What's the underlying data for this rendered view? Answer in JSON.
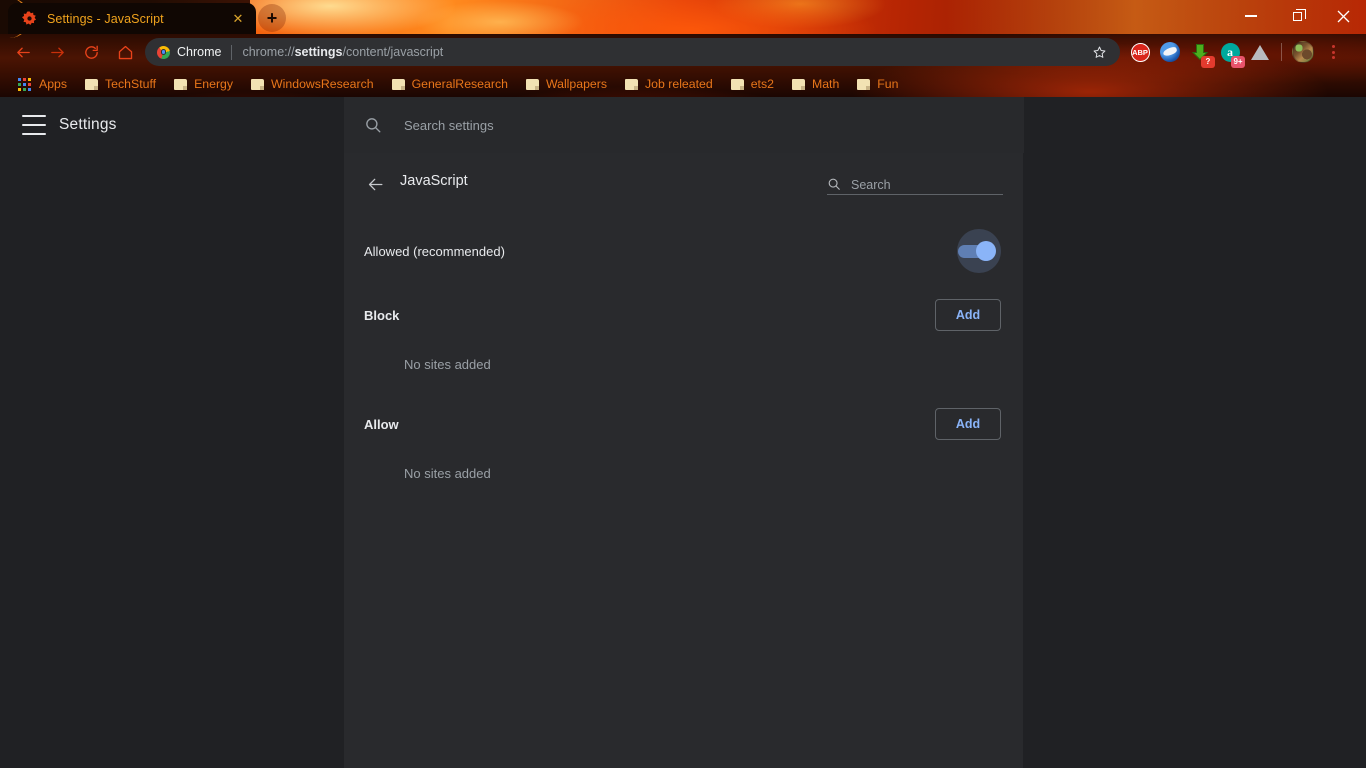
{
  "window": {
    "controls": [
      {
        "name": "minimize",
        "label": "–"
      },
      {
        "name": "maximize",
        "label": "❐"
      },
      {
        "name": "close",
        "label": "✕"
      }
    ]
  },
  "browser": {
    "tab": {
      "title": "Settings - JavaScript",
      "favicon": "gear-icon",
      "close_label": "✕"
    },
    "newtab_label": "+",
    "nav": {
      "back": "back-arrow-icon",
      "forward": "forward-arrow-icon",
      "reload": "reload-icon",
      "home": "home-icon"
    },
    "omnibox": {
      "chip_label": "Chrome",
      "url_prefix": "chrome://",
      "url_bold": "settings",
      "url_suffix": "/content/javascript",
      "full_url": "chrome://settings/content/javascript",
      "star_label": "☆"
    },
    "extensions": [
      {
        "name": "adblock-plus-icon",
        "label": "ABP",
        "badge": ""
      },
      {
        "name": "blue-globe-extension-icon",
        "label": "",
        "badge": ""
      },
      {
        "name": "download-extension-icon",
        "label": "",
        "badge": "?"
      },
      {
        "name": "a-extension-icon",
        "label": "a",
        "badge": "9+"
      },
      {
        "name": "triangle-extension-icon",
        "label": "",
        "badge": ""
      }
    ],
    "profile": {
      "name": "avatar"
    },
    "menu_label": "⋮",
    "bookmarks": [
      {
        "name": "apps",
        "label": "Apps",
        "icon": "apps-grid-icon"
      },
      {
        "name": "techstuff",
        "label": "TechStuff",
        "icon": "folder-icon"
      },
      {
        "name": "energy",
        "label": "Energy",
        "icon": "folder-icon"
      },
      {
        "name": "windowsresearch",
        "label": "WindowsResearch",
        "icon": "folder-icon"
      },
      {
        "name": "generalresearch",
        "label": "GeneralResearch",
        "icon": "folder-icon"
      },
      {
        "name": "wallpapers",
        "label": "Wallpapers",
        "icon": "folder-icon"
      },
      {
        "name": "job-releated",
        "label": "Job releated",
        "icon": "folder-icon"
      },
      {
        "name": "ets2",
        "label": "ets2",
        "icon": "folder-icon"
      },
      {
        "name": "math",
        "label": "Math",
        "icon": "folder-icon"
      },
      {
        "name": "fun",
        "label": "Fun",
        "icon": "folder-icon"
      }
    ]
  },
  "settings": {
    "app_title": "Settings",
    "search_placeholder": "Search settings",
    "page": {
      "title": "JavaScript",
      "search_placeholder": "Search",
      "toggle": {
        "label": "Allowed (recommended)",
        "state": "on"
      },
      "sections": [
        {
          "id": "block",
          "title": "Block",
          "add_label": "Add",
          "empty_text": "No sites added"
        },
        {
          "id": "allow",
          "title": "Allow",
          "add_label": "Add",
          "empty_text": "No sites added"
        }
      ]
    }
  },
  "colors": {
    "accent": "#8ab4f8",
    "page_bg": "#202124",
    "card_bg": "#292a2d",
    "theme_orange": "#e8761a",
    "tab_text": "#f0a31d"
  }
}
